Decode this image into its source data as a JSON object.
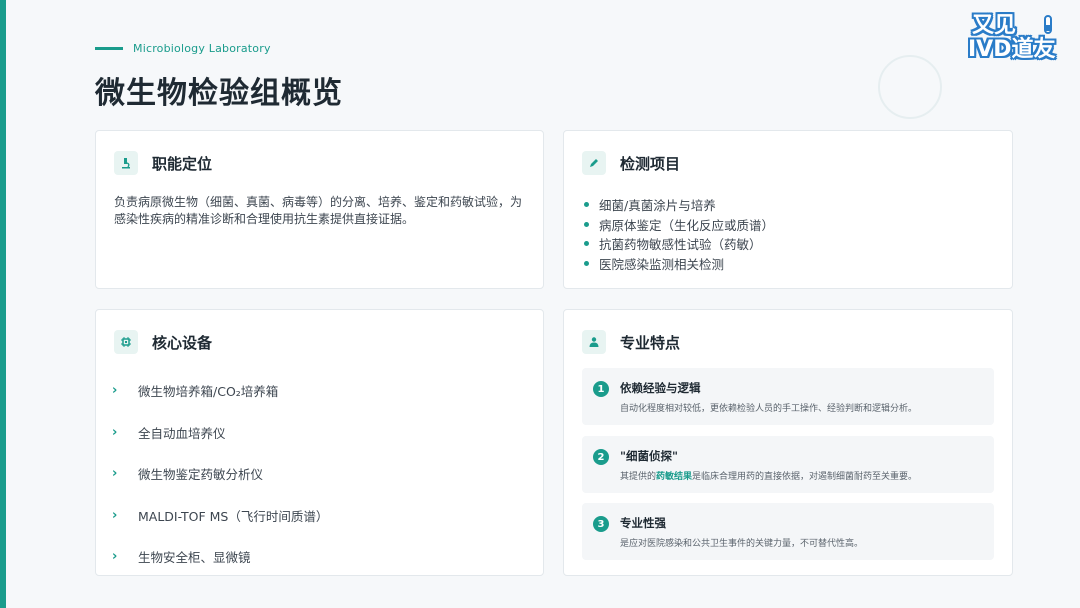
{
  "header": {
    "kicker": "Microbiology Laboratory",
    "title": "微生物检验组概览"
  },
  "logo": {
    "line1": "又见",
    "line2": "IVD道友"
  },
  "colors": {
    "accent": "#1a9c8c",
    "logo_blue": "#2a7cc8"
  },
  "cards": {
    "role": {
      "icon": "microscope-icon",
      "title": "职能定位",
      "desc": "负责病原微生物（细菌、真菌、病毒等）的分离、培养、鉴定和药敏试验，为感染性疾病的精准诊断和合理使用抗生素提供直接证据。"
    },
    "tests": {
      "icon": "pencil-icon",
      "title": "检测项目",
      "items": [
        "细菌/真菌涂片与培养",
        "病原体鉴定（生化反应或质谱）",
        "抗菌药物敏感性试验（药敏）",
        "医院感染监测相关检测"
      ]
    },
    "equipment": {
      "icon": "chip-icon",
      "title": "核心设备",
      "items": [
        "微生物培养箱/CO₂培养箱",
        "全自动血培养仪",
        "微生物鉴定药敏分析仪",
        "MALDI-TOF MS（飞行时间质谱）",
        "生物安全柜、显微镜"
      ]
    },
    "features": {
      "icon": "user-icon",
      "title": "专业特点",
      "items": [
        {
          "num": "1",
          "title": "依赖经验与逻辑",
          "desc": "自动化程度相对较低，更依赖检验人员的手工操作、经验判断和逻辑分析。"
        },
        {
          "num": "2",
          "title": "\"细菌侦探\"",
          "desc_before": "其提供的",
          "desc_highlight": "药敏结果",
          "desc_after": "是临床合理用药的直接依据，对遏制细菌耐药至关重要。"
        },
        {
          "num": "3",
          "title": "专业性强",
          "desc": "是应对医院感染和公共卫生事件的关键力量，不可替代性高。"
        }
      ]
    }
  }
}
